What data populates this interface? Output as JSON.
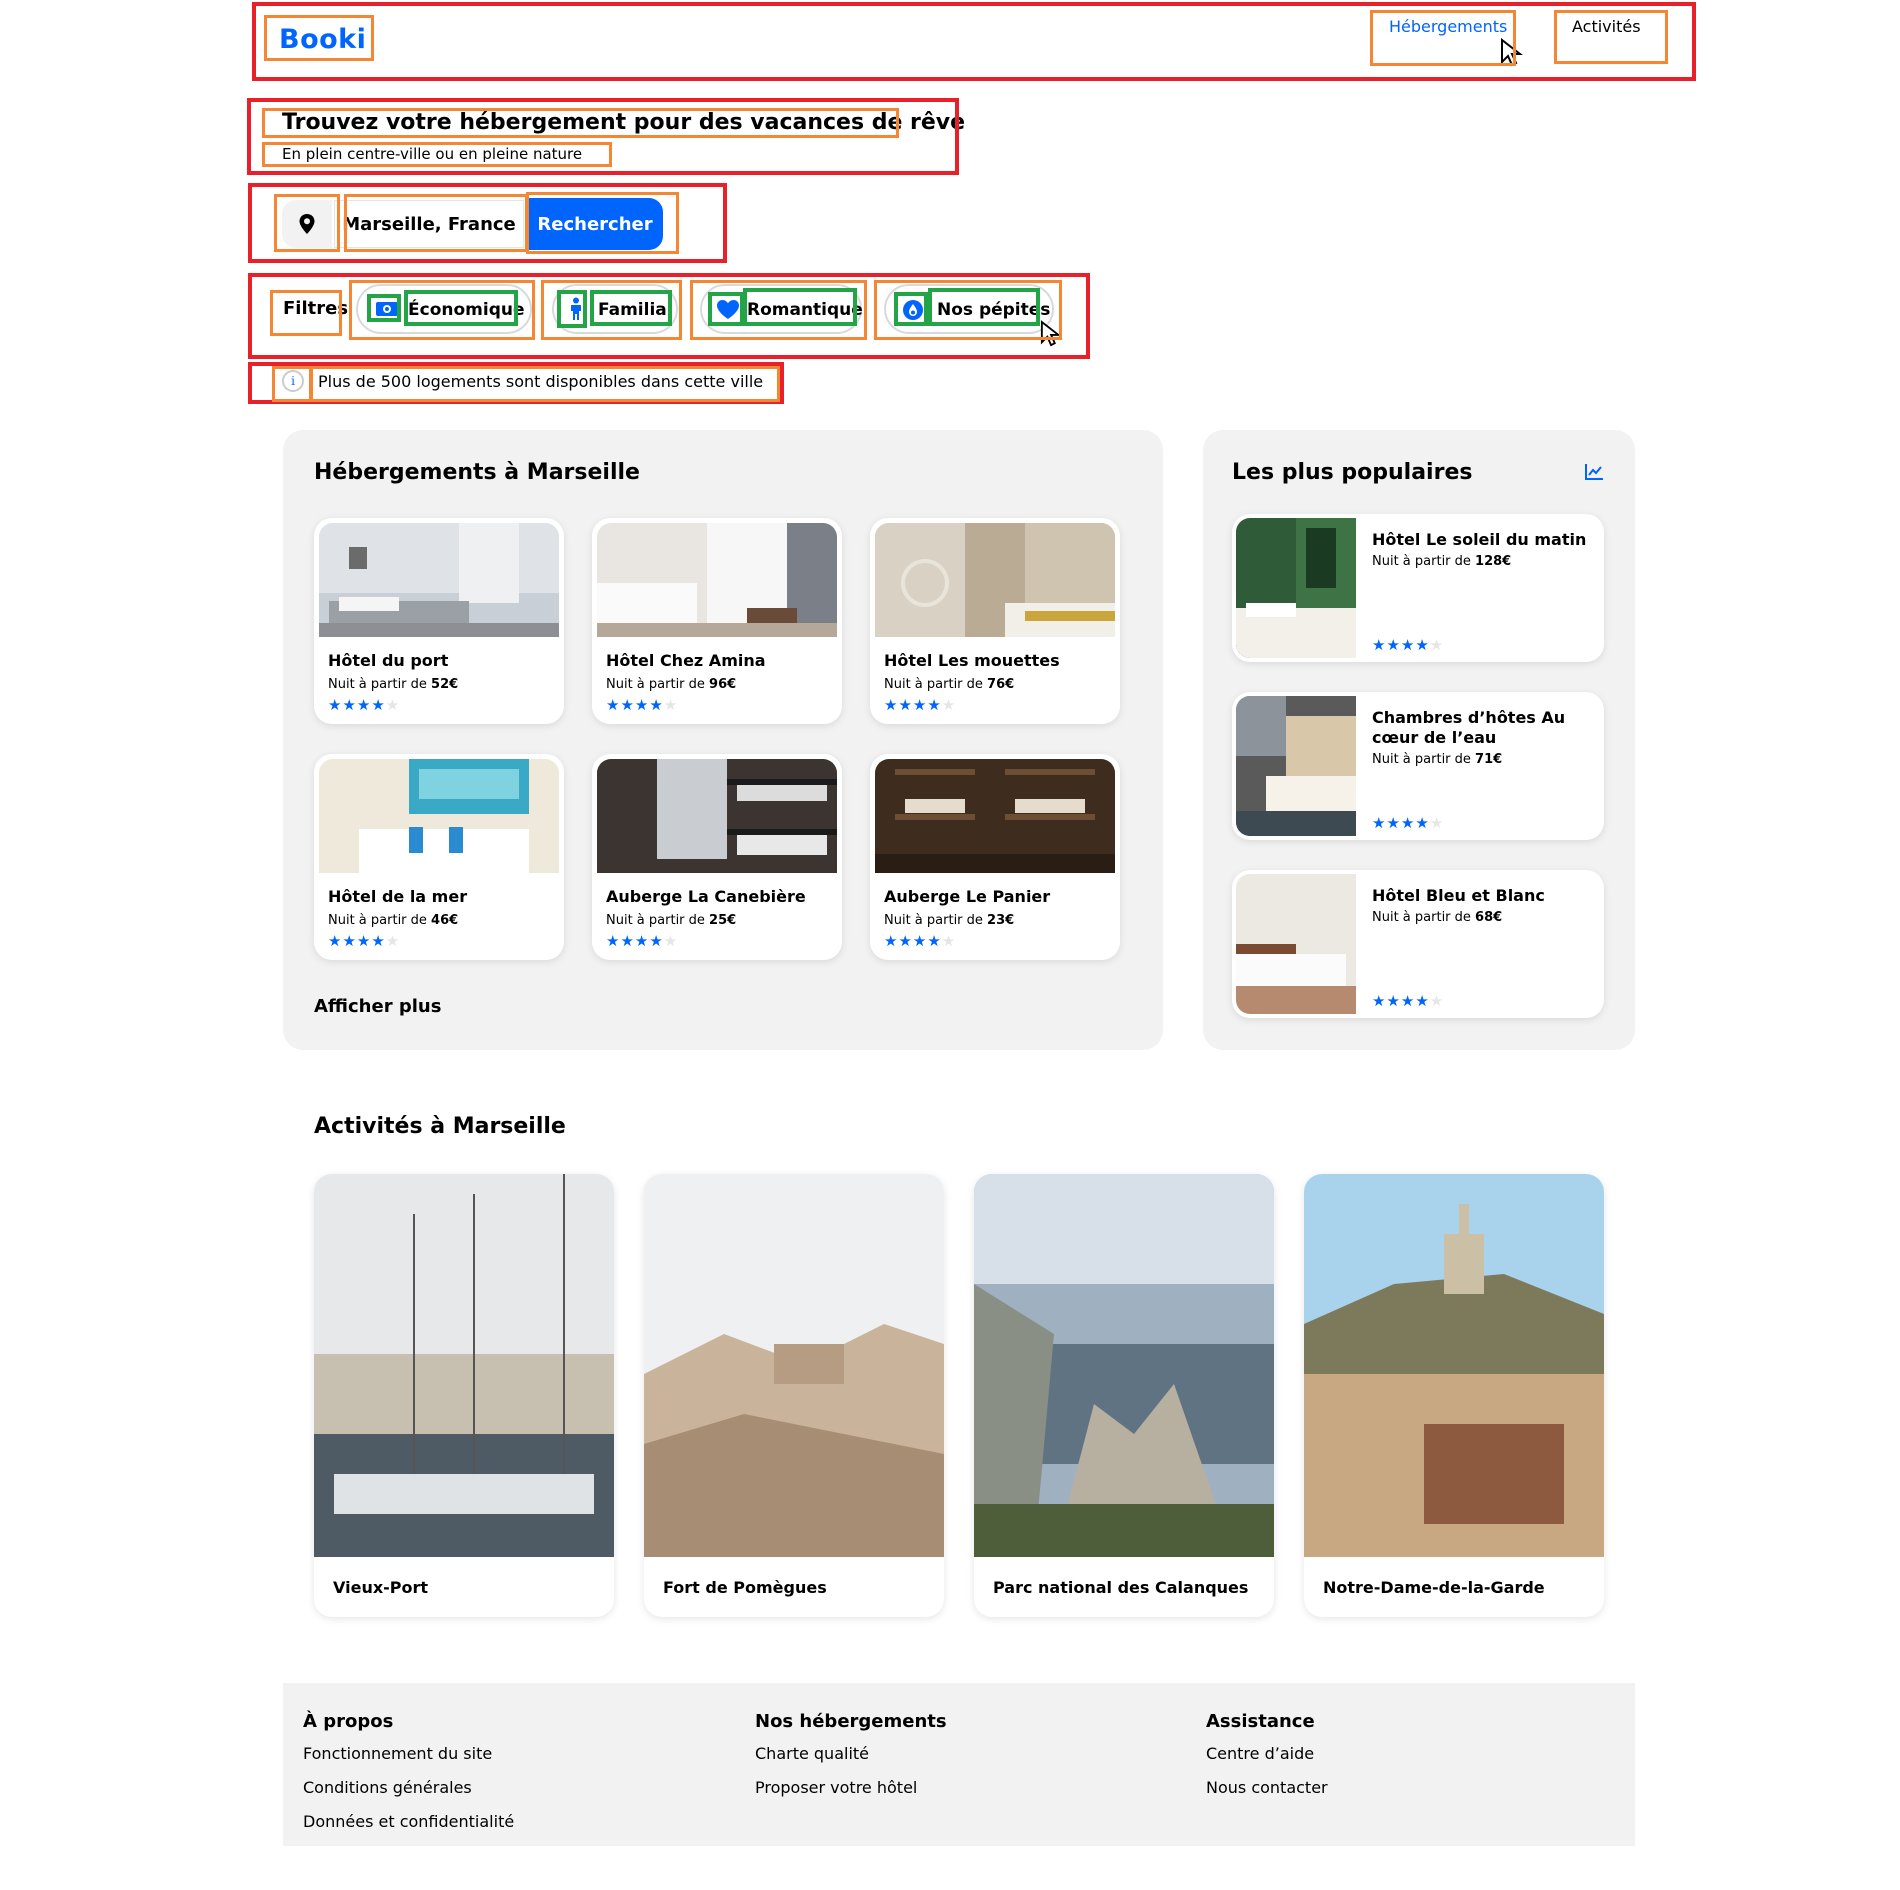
{
  "header": {
    "logo": "Booki",
    "nav": [
      {
        "label": "Hébergements",
        "active": true
      },
      {
        "label": "Activités",
        "active": false
      }
    ]
  },
  "hero": {
    "title": "Trouvez votre hébergement pour des vacances de rêve",
    "subtitle": "En plein centre-ville ou en pleine nature"
  },
  "search": {
    "icon": "location-pin-icon",
    "value": "Marseille, France",
    "button_label": "Rechercher"
  },
  "filters": {
    "label": "Filtres",
    "chips": [
      {
        "label": "Économique",
        "icon": "money-icon"
      },
      {
        "label": "Familial",
        "icon": "child-icon"
      },
      {
        "label": "Romantique",
        "icon": "heart-icon"
      },
      {
        "label": "Nos pépites",
        "icon": "gem-icon"
      }
    ]
  },
  "info": {
    "icon": "info-icon",
    "text": "Plus de 500 logements sont disponibles dans cette ville"
  },
  "accommodations": {
    "title": "Hébergements à Marseille",
    "price_prefix": "Nuit à partir de",
    "items": [
      {
        "name": "Hôtel du port",
        "price": "52€",
        "rating": 4
      },
      {
        "name": "Hôtel Chez Amina",
        "price": "96€",
        "rating": 4
      },
      {
        "name": "Hôtel Les mouettes",
        "price": "76€",
        "rating": 4
      },
      {
        "name": "Hôtel de la mer",
        "price": "46€",
        "rating": 4
      },
      {
        "name": "Auberge La Canebière",
        "price": "25€",
        "rating": 4
      },
      {
        "name": "Auberge Le Panier",
        "price": "23€",
        "rating": 4
      }
    ],
    "more_label": "Afficher plus"
  },
  "popular": {
    "title": "Les plus populaires",
    "icon": "trend-chart-icon",
    "price_prefix": "Nuit à partir de",
    "items": [
      {
        "name": "Hôtel Le soleil du matin",
        "price": "128€",
        "rating": 4
      },
      {
        "name": "Chambres d’hôtes Au cœur de l’eau",
        "price": "71€",
        "rating": 4
      },
      {
        "name": "Hôtel Bleu et Blanc",
        "price": "68€",
        "rating": 4
      }
    ]
  },
  "activities": {
    "title": "Activités à Marseille",
    "items": [
      {
        "name": "Vieux-Port"
      },
      {
        "name": "Fort de Pomègues"
      },
      {
        "name": "Parc national des Calanques"
      },
      {
        "name": "Notre-Dame-de-la-Garde"
      }
    ]
  },
  "footer": {
    "columns": [
      {
        "title": "À propos",
        "links": [
          "Fonctionnement du site",
          "Conditions générales",
          "Données et confidentialité"
        ]
      },
      {
        "title": "Nos hébergements",
        "links": [
          "Charte qualité",
          "Proposer votre hôtel"
        ]
      },
      {
        "title": "Assistance",
        "links": [
          "Centre d’aide",
          "Nous contacter"
        ]
      }
    ]
  },
  "colors": {
    "accent": "#0065fc",
    "panel_bg": "#f2f2f2",
    "annotation_red": "#e8202a",
    "annotation_orange": "#f58634",
    "annotation_green": "#22a447"
  }
}
